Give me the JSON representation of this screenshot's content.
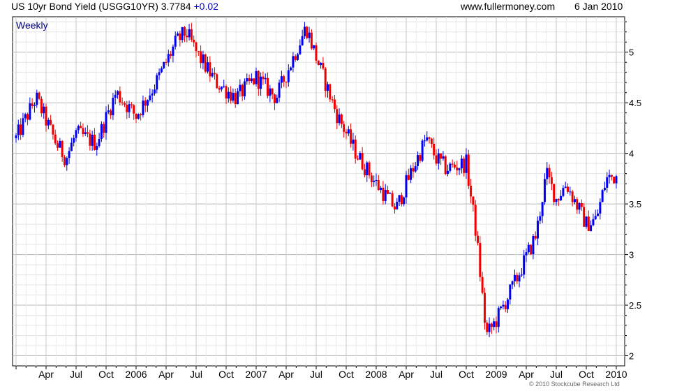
{
  "header": {
    "instrument": "US 10yr Bond Yield (USGG10YR)",
    "last": "3.7784",
    "change": "+0.02",
    "site": "www.fullermoney.com",
    "date": "6 Jan 2010"
  },
  "chart_data": {
    "type": "candlestick",
    "period_label": "Weekly",
    "y_ticks": [
      "2",
      "2.5",
      "3",
      "3.5",
      "4",
      "4.5",
      "5"
    ],
    "y_range": [
      1.9,
      5.35
    ],
    "x_ticks": [
      "Apr",
      "Jul",
      "Oct",
      "2006",
      "Apr",
      "Jul",
      "Oct",
      "2007",
      "Apr",
      "Jul",
      "Oct",
      "2008",
      "Apr",
      "Jul",
      "Oct",
      "2009",
      "Apr",
      "Jul",
      "Oct",
      "2010"
    ],
    "x_start": "2005-01",
    "x_end": "2010-01",
    "grid": true,
    "up_color": "#0000ee",
    "down_color": "#ee0000",
    "anchors": [
      [
        "2005-01",
        4.15
      ],
      [
        "2005-03",
        4.55
      ],
      [
        "2005-05",
        4.1
      ],
      [
        "2005-06",
        3.95
      ],
      [
        "2005-07",
        4.2
      ],
      [
        "2005-09",
        4.1
      ],
      [
        "2005-11",
        4.6
      ],
      [
        "2006-01",
        4.37
      ],
      [
        "2006-03",
        4.7
      ],
      [
        "2006-05",
        5.1
      ],
      [
        "2006-06",
        5.2
      ],
      [
        "2006-07",
        5.0
      ],
      [
        "2006-09",
        4.7
      ],
      [
        "2006-11",
        4.55
      ],
      [
        "2007-01",
        4.75
      ],
      [
        "2007-03",
        4.55
      ],
      [
        "2007-06",
        5.25
      ],
      [
        "2007-07",
        4.95
      ],
      [
        "2007-09",
        4.4
      ],
      [
        "2007-11",
        4.0
      ],
      [
        "2008-01",
        3.7
      ],
      [
        "2008-03",
        3.45
      ],
      [
        "2008-04",
        3.7
      ],
      [
        "2008-06",
        4.15
      ],
      [
        "2008-07",
        3.95
      ],
      [
        "2008-08",
        3.85
      ],
      [
        "2008-10",
        3.9
      ],
      [
        "2008-11",
        3.2
      ],
      [
        "2008-12",
        2.2
      ],
      [
        "2009-01",
        2.35
      ],
      [
        "2009-03",
        2.75
      ],
      [
        "2009-05",
        3.2
      ],
      [
        "2009-06",
        3.8
      ],
      [
        "2009-07",
        3.55
      ],
      [
        "2009-08",
        3.7
      ],
      [
        "2009-10",
        3.3
      ],
      [
        "2009-11",
        3.35
      ],
      [
        "2009-12",
        3.75
      ],
      [
        "2010-01",
        3.78
      ]
    ]
  },
  "footer": {
    "copyright": "© 2010 Stockcube Research Ltd"
  }
}
